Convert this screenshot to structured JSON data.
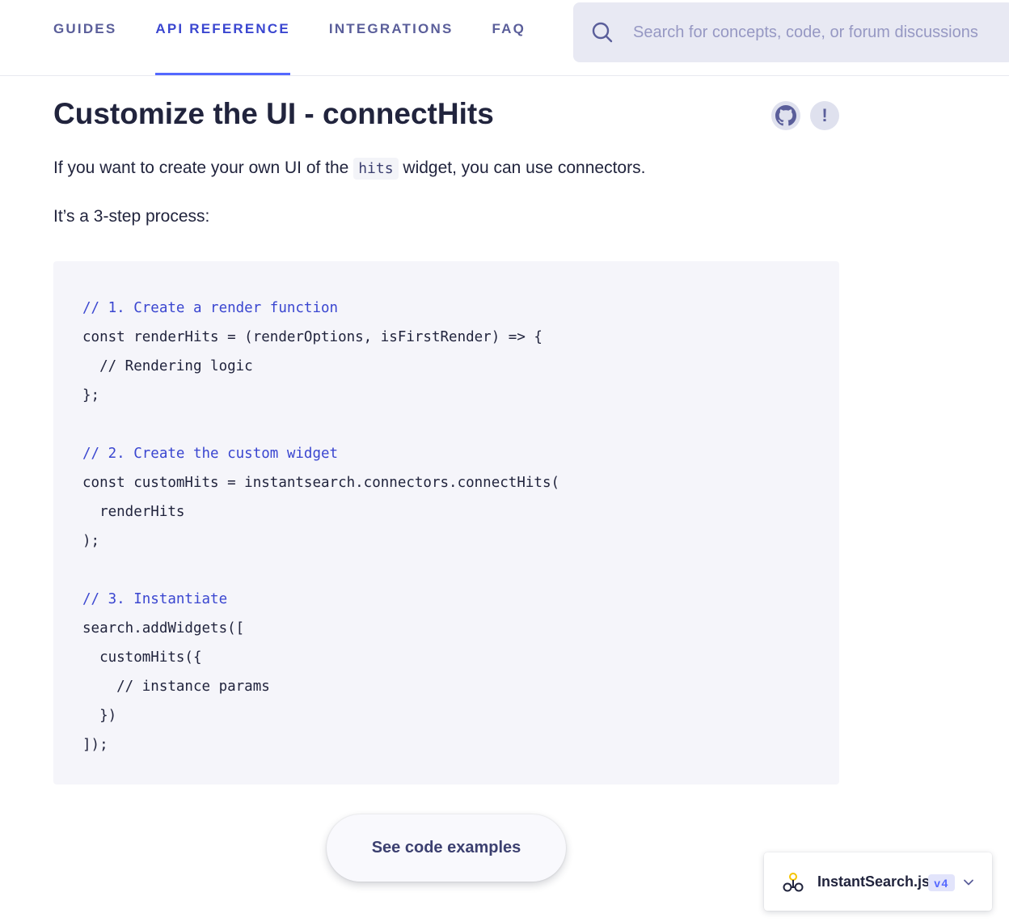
{
  "nav": {
    "items": [
      {
        "label": "GUIDES",
        "active": false
      },
      {
        "label": "API REFERENCE",
        "active": true
      },
      {
        "label": "INTEGRATIONS",
        "active": false
      },
      {
        "label": "FAQ",
        "active": false
      }
    ]
  },
  "search": {
    "placeholder": "Search for concepts, code, or forum discussions",
    "value": "",
    "icon": "search-icon"
  },
  "page": {
    "title": "Customize the UI - connectHits",
    "github_icon": "github-icon",
    "issue_icon": "exclamation-icon",
    "issue_label": "!",
    "intro_before": "If you want to create your own UI of the ",
    "intro_code": "hits",
    "intro_after": " widget, you can use connectors.",
    "steps_text": "It’s a 3-step process:"
  },
  "code": {
    "lines": [
      {
        "text": "// 1. Create a render function",
        "comment": true
      },
      {
        "text": "const renderHits = (renderOptions, isFirstRender) => {",
        "comment": false
      },
      {
        "text": "  // Rendering logic",
        "comment": false
      },
      {
        "text": "};",
        "comment": false
      },
      {
        "text": "",
        "comment": false
      },
      {
        "text": "// 2. Create the custom widget",
        "comment": true
      },
      {
        "text": "const customHits = instantsearch.connectors.connectHits(",
        "comment": false
      },
      {
        "text": "  renderHits",
        "comment": false
      },
      {
        "text": ");",
        "comment": false
      },
      {
        "text": "",
        "comment": false
      },
      {
        "text": "// 3. Instantiate",
        "comment": true
      },
      {
        "text": "search.addWidgets([",
        "comment": false
      },
      {
        "text": "  customHits({",
        "comment": false
      },
      {
        "text": "    // instance params",
        "comment": false
      },
      {
        "text": "  })",
        "comment": false
      },
      {
        "text": "]);",
        "comment": false
      }
    ]
  },
  "examples_button": {
    "label": "See code examples"
  },
  "version_switcher": {
    "logo_icon": "instantsearch-logo-icon",
    "name": "InstantSearch.js",
    "version": "v4",
    "chevron_icon": "chevron-down-icon"
  },
  "colors": {
    "accent": "#5468ff",
    "active_nav": "#3a46d0",
    "text": "#21243d",
    "code_bg": "#f5f5fa"
  }
}
